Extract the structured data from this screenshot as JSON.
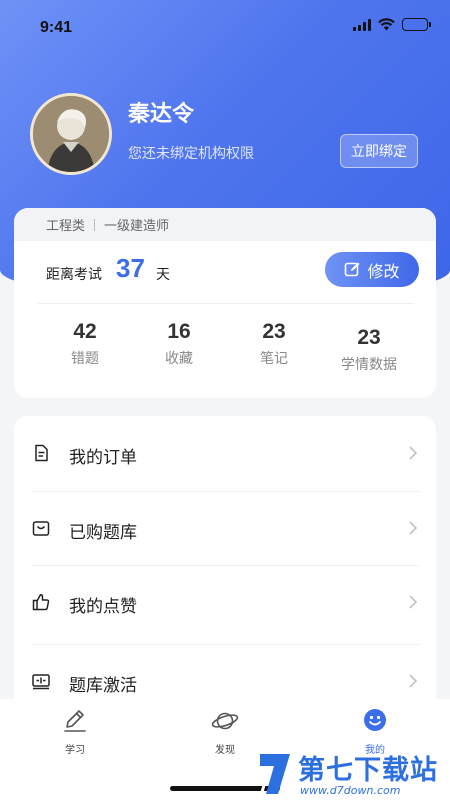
{
  "status_bar": {
    "time": "9:41"
  },
  "profile": {
    "name": "秦达令",
    "subtitle": "您还未绑定机构权限",
    "bind_button": "立即绑定"
  },
  "stats_card": {
    "category": "工程类",
    "subcategory": "一级建造师",
    "exam_label": "距离考试",
    "exam_days": "37",
    "exam_unit": "天",
    "edit_button": "修改",
    "stats": [
      {
        "value": "42",
        "label": "错题"
      },
      {
        "value": "16",
        "label": "收藏"
      },
      {
        "value": "23",
        "label": "笔记"
      },
      {
        "value": "23",
        "label": "学情数据"
      }
    ]
  },
  "menu": [
    {
      "label": "我的订单",
      "icon": "document-icon"
    },
    {
      "label": "已购题库",
      "icon": "bag-icon"
    },
    {
      "label": "我的点赞",
      "icon": "thumbs-up-icon"
    },
    {
      "label": "题库激活",
      "icon": "activate-icon"
    }
  ],
  "tabbar": [
    {
      "label": "学习",
      "icon": "pencil-icon",
      "active": false
    },
    {
      "label": "发现",
      "icon": "planet-icon",
      "active": false
    },
    {
      "label": "我的",
      "icon": "smile-icon",
      "active": true
    }
  ],
  "watermark": {
    "title": "第七下载站",
    "url": "www.d7down.com"
  },
  "colors": {
    "primary": "#3d6ee9",
    "hero_start": "#6f92f7",
    "hero_end": "#3d66e8"
  }
}
